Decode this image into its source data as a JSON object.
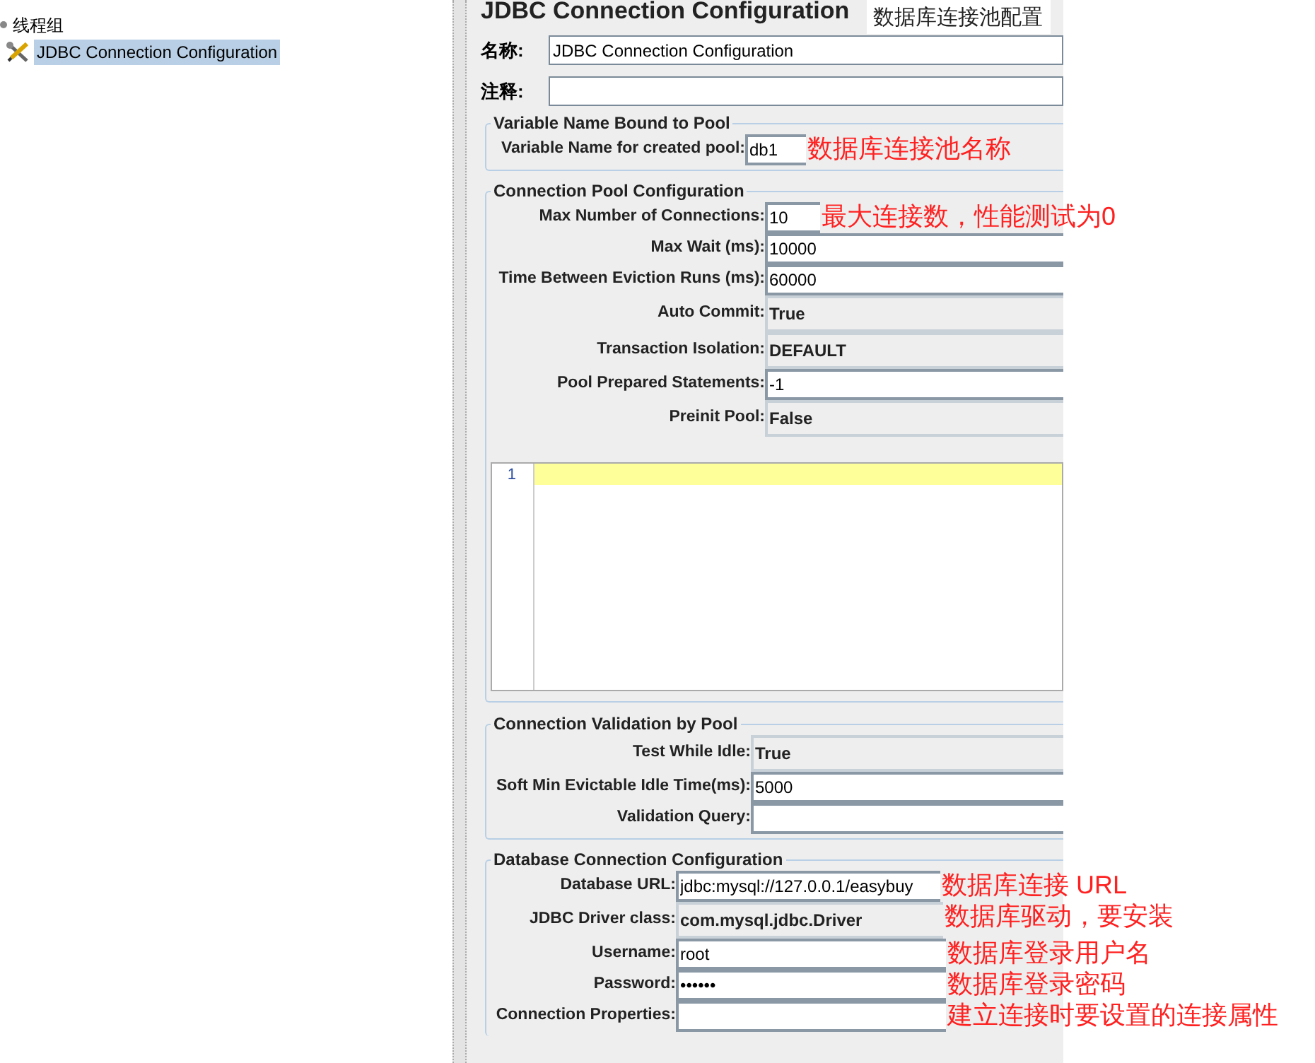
{
  "tree": {
    "items": [
      {
        "label": "线程组",
        "kind": "group",
        "selected": false
      },
      {
        "label": "JDBC Connection Configuration",
        "kind": "config",
        "selected": true
      }
    ]
  },
  "panel": {
    "title": "JDBC Connection Configuration",
    "caption": "数据库连接池配置",
    "name_field": {
      "label": "名称:",
      "value": "JDBC Connection Configuration"
    },
    "comment_field": {
      "label": "注释:"
    },
    "sections": [
      {
        "title": "Variable Name Bound to Pool",
        "rows": [
          {
            "label": "Variable Name for created pool:",
            "value": "db1",
            "kind": "text",
            "note": "数据库连接池名称"
          }
        ]
      },
      {
        "title": "Connection Pool Configuration",
        "rows": [
          {
            "label": "Max Number of Connections:",
            "value": "10",
            "kind": "text",
            "note": "最大连接数，性能测试为0"
          },
          {
            "label": "Max Wait (ms):",
            "value": "10000",
            "kind": "text"
          },
          {
            "label": "Time Between Eviction Runs (ms):",
            "value": "60000",
            "kind": "text"
          },
          {
            "label": "Auto Commit:",
            "value": "True",
            "kind": "combo"
          },
          {
            "label": "Transaction Isolation:",
            "value": "DEFAULT",
            "kind": "combo"
          },
          {
            "label": "Pool Prepared Statements:",
            "value": "-1",
            "kind": "text"
          },
          {
            "label": "Preinit Pool:",
            "value": "False",
            "kind": "combo"
          }
        ],
        "editor": {
          "line_numbers": [
            "1"
          ]
        }
      },
      {
        "title": "Connection Validation by Pool",
        "rows": [
          {
            "label": "Test While Idle:",
            "value": "True",
            "kind": "combo"
          },
          {
            "label": "Soft Min Evictable Idle Time(ms):",
            "value": "5000",
            "kind": "text"
          },
          {
            "label": "Validation Query:",
            "kind": "text"
          }
        ]
      },
      {
        "title": "Database Connection Configuration",
        "rows": [
          {
            "label": "Database URL:",
            "value": "jdbc:mysql://127.0.0.1/easybuy",
            "kind": "text",
            "note": "数据库连接 URL"
          },
          {
            "label": "JDBC Driver class:",
            "value": "com.mysql.jdbc.Driver",
            "kind": "combo",
            "note": "数据库驱动，要安装"
          },
          {
            "label": "Username:",
            "value": "root",
            "kind": "text",
            "note": "数据库登录用户名"
          },
          {
            "label": "Password:",
            "value": "••••••",
            "kind": "text",
            "note": "数据库登录密码"
          },
          {
            "label": "Connection Properties:",
            "kind": "text",
            "note": "建立连接时要设置的连接属性"
          }
        ]
      }
    ]
  }
}
